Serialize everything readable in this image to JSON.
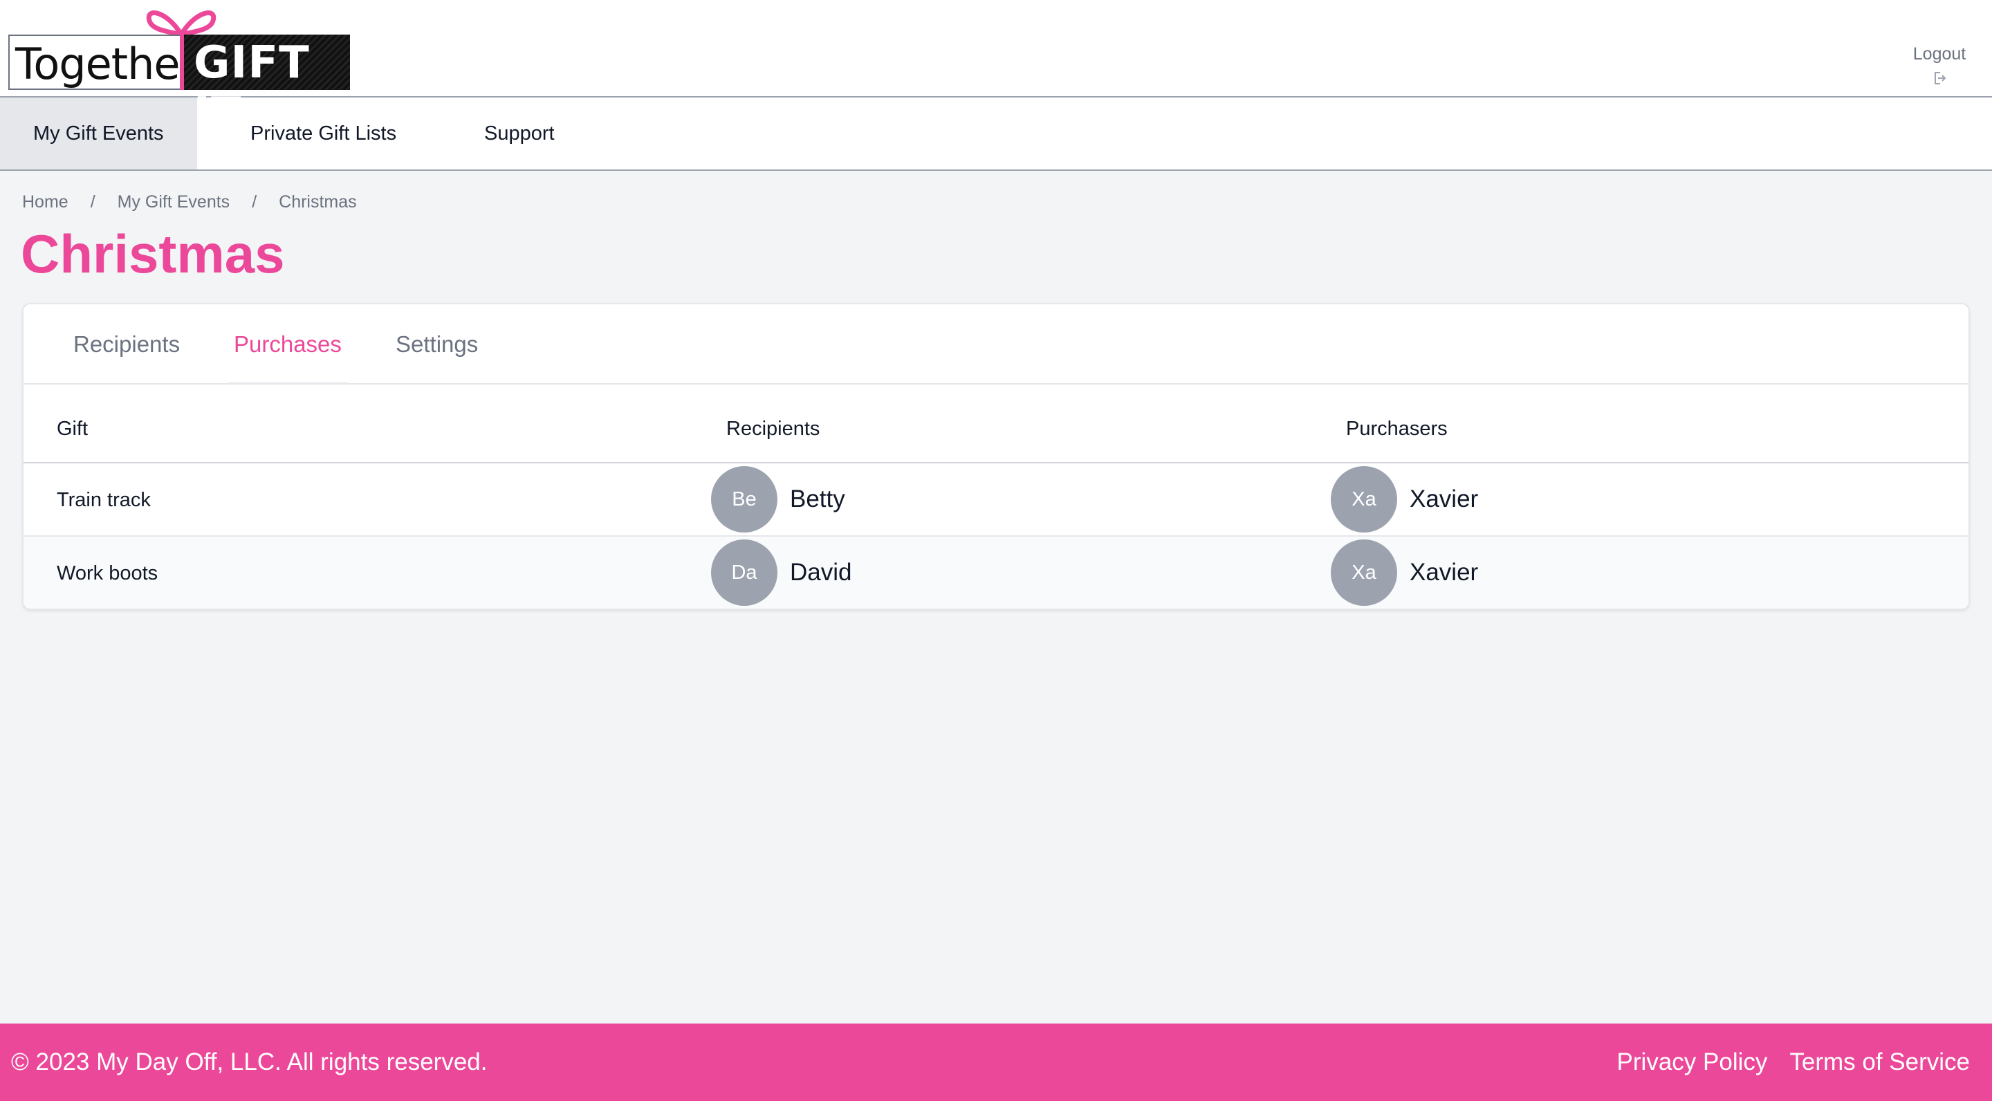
{
  "header": {
    "logo": {
      "left_text": "Together",
      "right_text": "GIFT IT"
    },
    "logout_label": "Logout",
    "accent": "#ec4899"
  },
  "nav": {
    "items": [
      {
        "label": "My Gift Events",
        "active": true
      },
      {
        "label": "Private Gift Lists",
        "active": false
      },
      {
        "label": "Support",
        "active": false
      }
    ]
  },
  "breadcrumb": {
    "items": [
      "Home",
      "My Gift Events",
      "Christmas"
    ],
    "separator": "/"
  },
  "page": {
    "title": "Christmas"
  },
  "tabs": [
    {
      "label": "Recipients",
      "active": false
    },
    {
      "label": "Purchases",
      "active": true
    },
    {
      "label": "Settings",
      "active": false
    }
  ],
  "table": {
    "headers": [
      "Gift",
      "Recipients",
      "Purchasers"
    ],
    "rows": [
      {
        "gift": "Train track",
        "recipient": {
          "initials": "Be",
          "name": "Betty"
        },
        "purchaser": {
          "initials": "Xa",
          "name": "Xavier"
        }
      },
      {
        "gift": "Work boots",
        "recipient": {
          "initials": "Da",
          "name": "David"
        },
        "purchaser": {
          "initials": "Xa",
          "name": "Xavier"
        }
      }
    ]
  },
  "footer": {
    "copyright": "© 2023 My Day Off, LLC. All rights reserved.",
    "links": [
      "Privacy Policy",
      "Terms of Service"
    ]
  }
}
